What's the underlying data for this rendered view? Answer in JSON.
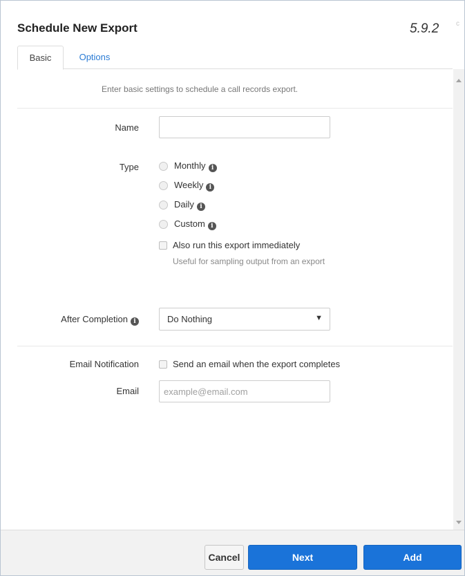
{
  "dialog": {
    "title": "Schedule New Export",
    "version": "5.9.2",
    "corner_mark": "c"
  },
  "tabs": [
    {
      "label": "Basic",
      "active": true
    },
    {
      "label": "Options",
      "active": false
    }
  ],
  "intro_text": "Enter basic settings to schedule a call records export.",
  "form": {
    "name": {
      "label": "Name",
      "value": "",
      "placeholder": ""
    },
    "type": {
      "label": "Type",
      "options": [
        {
          "label": "Monthly",
          "selected": false
        },
        {
          "label": "Weekly",
          "selected": false
        },
        {
          "label": "Daily",
          "selected": false
        },
        {
          "label": "Custom",
          "selected": false
        }
      ]
    },
    "run_immediately": {
      "label": "Also run this export immediately",
      "helper": "Useful for sampling output from an export",
      "checked": false
    },
    "after_completion": {
      "label": "After Completion",
      "value": "Do Nothing"
    },
    "email_notification": {
      "label": "Email Notification",
      "checkbox_label": "Send an email when the export completes",
      "checked": false
    },
    "email": {
      "label": "Email",
      "value": "",
      "placeholder": "example@email.com"
    }
  },
  "info_icon_glyph": "i",
  "footer": {
    "cancel_label": "Cancel",
    "next_label": "Next",
    "add_label": "Add"
  },
  "colors": {
    "primary": "#1a73d9",
    "link": "#2a7bd4",
    "footer_bg": "#f2f2f2"
  },
  "icons": {
    "info": "info-circle-icon",
    "dropdown": "triangle-down-icon",
    "scroll_up": "scroll-up-arrow-icon",
    "scroll_down": "scroll-down-arrow-icon"
  }
}
